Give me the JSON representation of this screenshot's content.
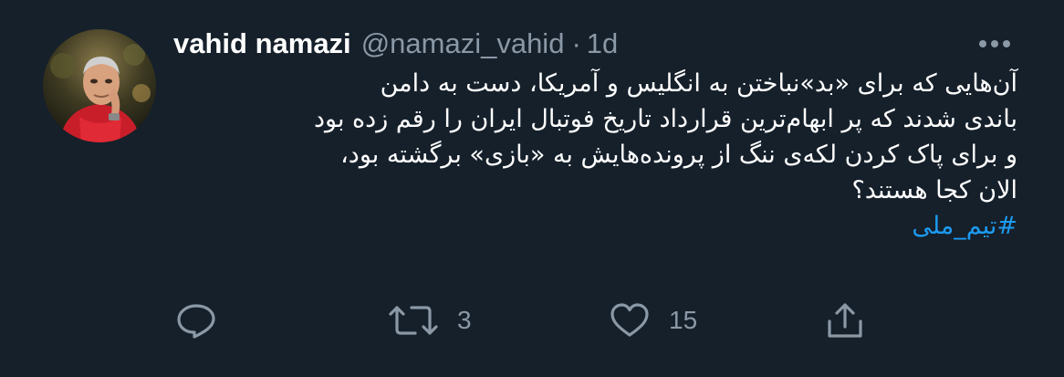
{
  "tweet": {
    "author": {
      "name": "vahid namazi",
      "handle": "@namazi_vahid",
      "separator": "·",
      "timestamp": "1d"
    },
    "body_lines": [
      "آن‌هایی که برای «بد»نباختن به انگلیس و آمریکا، دست به دامن",
      "باندی شدند که پر ابهام‌ترین قرارداد تاریخ فوتبال ایران را رقم زده بود",
      "و برای پاک کردن لکه‌ی ننگ از پرونده‌هایش به «بازی» برگشته بود،",
      "الان کجا هستند؟"
    ],
    "hashtag": "#تیم_ملی",
    "actions": {
      "reply": {
        "icon": "reply-icon",
        "count": ""
      },
      "retweet": {
        "icon": "retweet-icon",
        "count": "3"
      },
      "like": {
        "icon": "heart-icon",
        "count": "15"
      },
      "share": {
        "icon": "share-icon",
        "count": ""
      }
    }
  },
  "colors": {
    "background": "#15202b",
    "text": "#ffffff",
    "secondary": "#8b98a5",
    "link": "#1d9bf0"
  }
}
